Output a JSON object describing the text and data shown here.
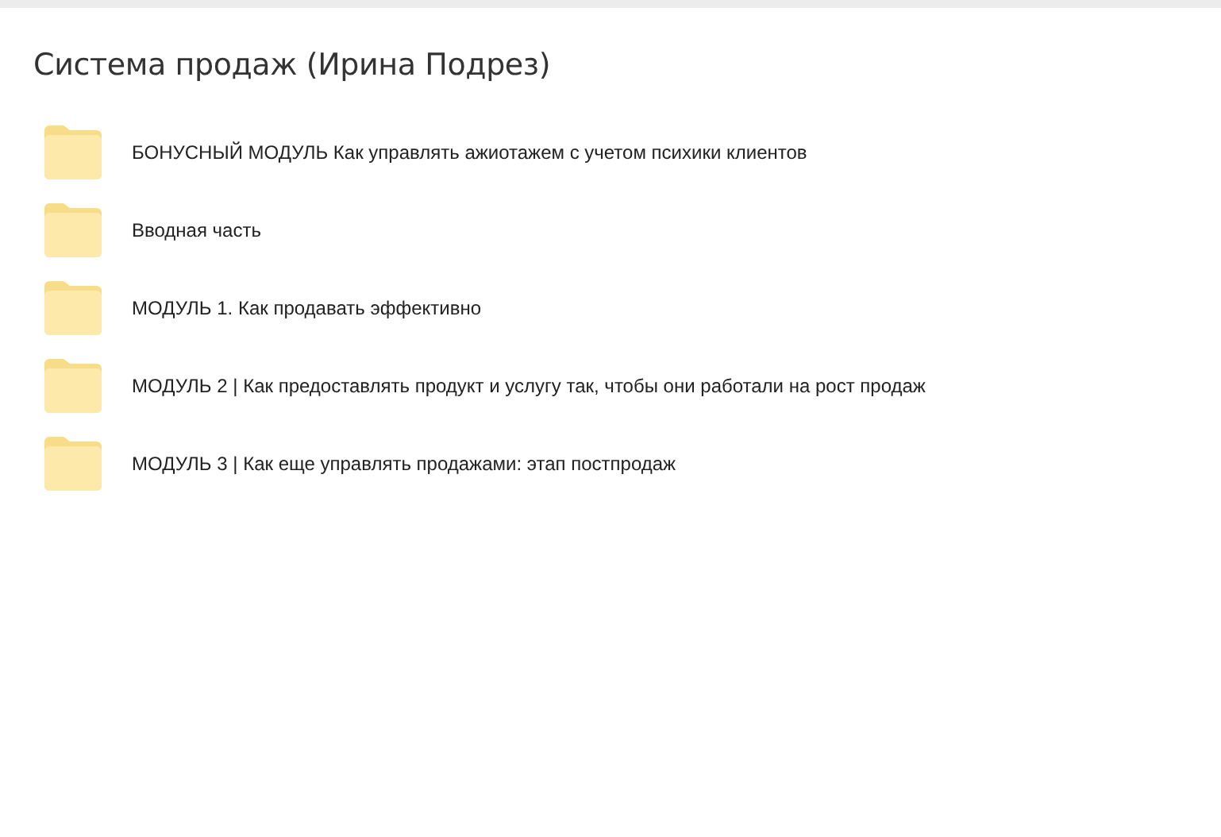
{
  "title": "Система продаж (Ирина Подрез)",
  "items": [
    {
      "name": "БОНУСНЫЙ МОДУЛЬ Как управлять ажиотажем с учетом психики клиентов"
    },
    {
      "name": "Вводная часть"
    },
    {
      "name": "МОДУЛЬ 1. Как продавать эффективно"
    },
    {
      "name": "МОДУЛЬ 2 | Как предоставлять продукт и услугу так, чтобы они работали на рост продаж"
    },
    {
      "name": "МОДУЛЬ 3 | Как еще управлять продажами: этап постпродаж"
    }
  ]
}
